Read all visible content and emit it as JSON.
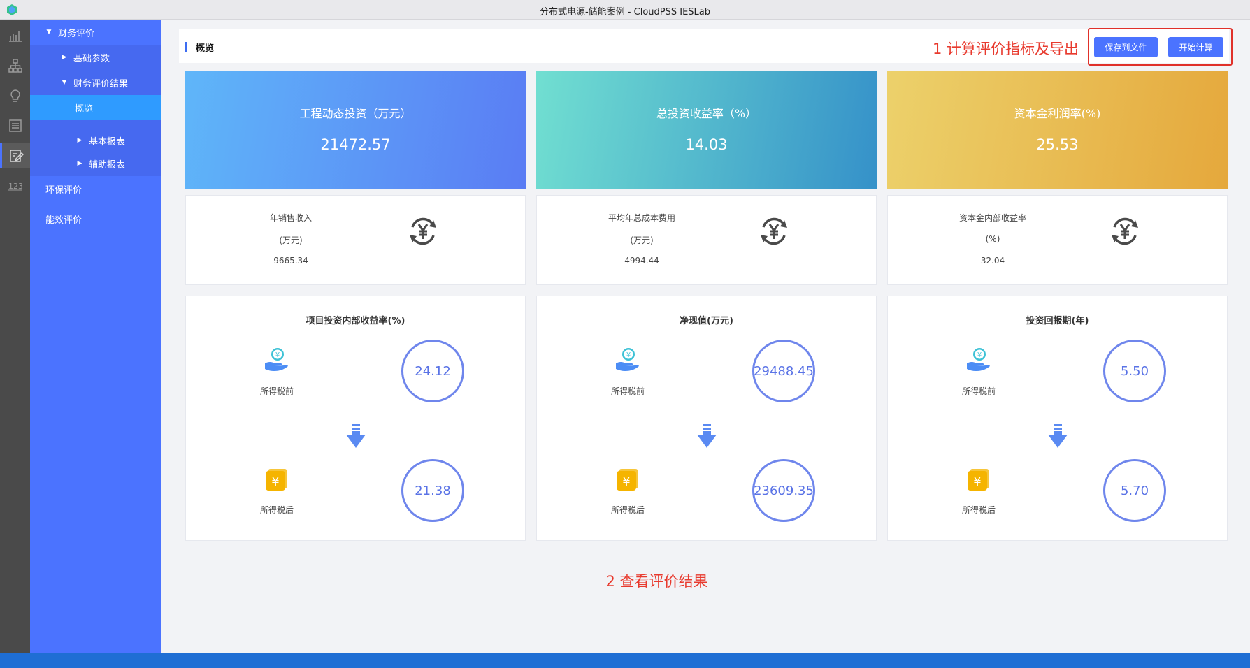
{
  "window": {
    "title": "分布式电源-储能案例 - CloudPSS IESLab"
  },
  "rail": {
    "items": [
      "chart-icon",
      "hierarchy-icon",
      "lightbulb-icon",
      "list-icon",
      "edit-report-icon",
      "numbers-icon"
    ]
  },
  "sidebar": {
    "finance_eval": "财务评价",
    "basic_params": "基础参数",
    "finance_results": "财务评价结果",
    "overview": "概览",
    "basic_reports": "基本报表",
    "aux_reports": "辅助报表",
    "env_eval": "环保评价",
    "energy_eval": "能效评价"
  },
  "header": {
    "title": "概览",
    "save_label": "保存到文件",
    "calc_label": "开始计算"
  },
  "annotations": {
    "step1": "1 计算评价指标及导出",
    "step2": "2 查看评价结果"
  },
  "summary_cards": [
    {
      "label": "工程动态投资（万元）",
      "value": "21472.57"
    },
    {
      "label": "总投资收益率（%）",
      "value": "14.03"
    },
    {
      "label": "资本金利润率(%)",
      "value": "25.53"
    }
  ],
  "info_cards": [
    {
      "label": "年销售收入",
      "unit": "(万元)",
      "value": "9665.34"
    },
    {
      "label": "平均年总成本费用",
      "unit": "(万元)",
      "value": "4994.44"
    },
    {
      "label": "资本金内部收益率",
      "unit": "(%)",
      "value": "32.04"
    }
  ],
  "metric_cards": [
    {
      "title": "项目投资内部收益率(%)",
      "pre_label": "所得税前",
      "pre_value": "24.12",
      "post_label": "所得税后",
      "post_value": "21.38"
    },
    {
      "title": "净现值(万元)",
      "pre_label": "所得税前",
      "pre_value": "29488.45",
      "post_label": "所得税后",
      "post_value": "23609.35"
    },
    {
      "title": "投资回报期(年)",
      "pre_label": "所得税前",
      "pre_value": "5.50",
      "post_label": "所得税后",
      "post_value": "5.70"
    }
  ],
  "colors": {
    "sidebar": "#4b73ff",
    "sidebar_selected": "#2f9bff",
    "accent": "#3d6df2",
    "annotation": "#e83a2e",
    "circle": "#6f86ec"
  }
}
